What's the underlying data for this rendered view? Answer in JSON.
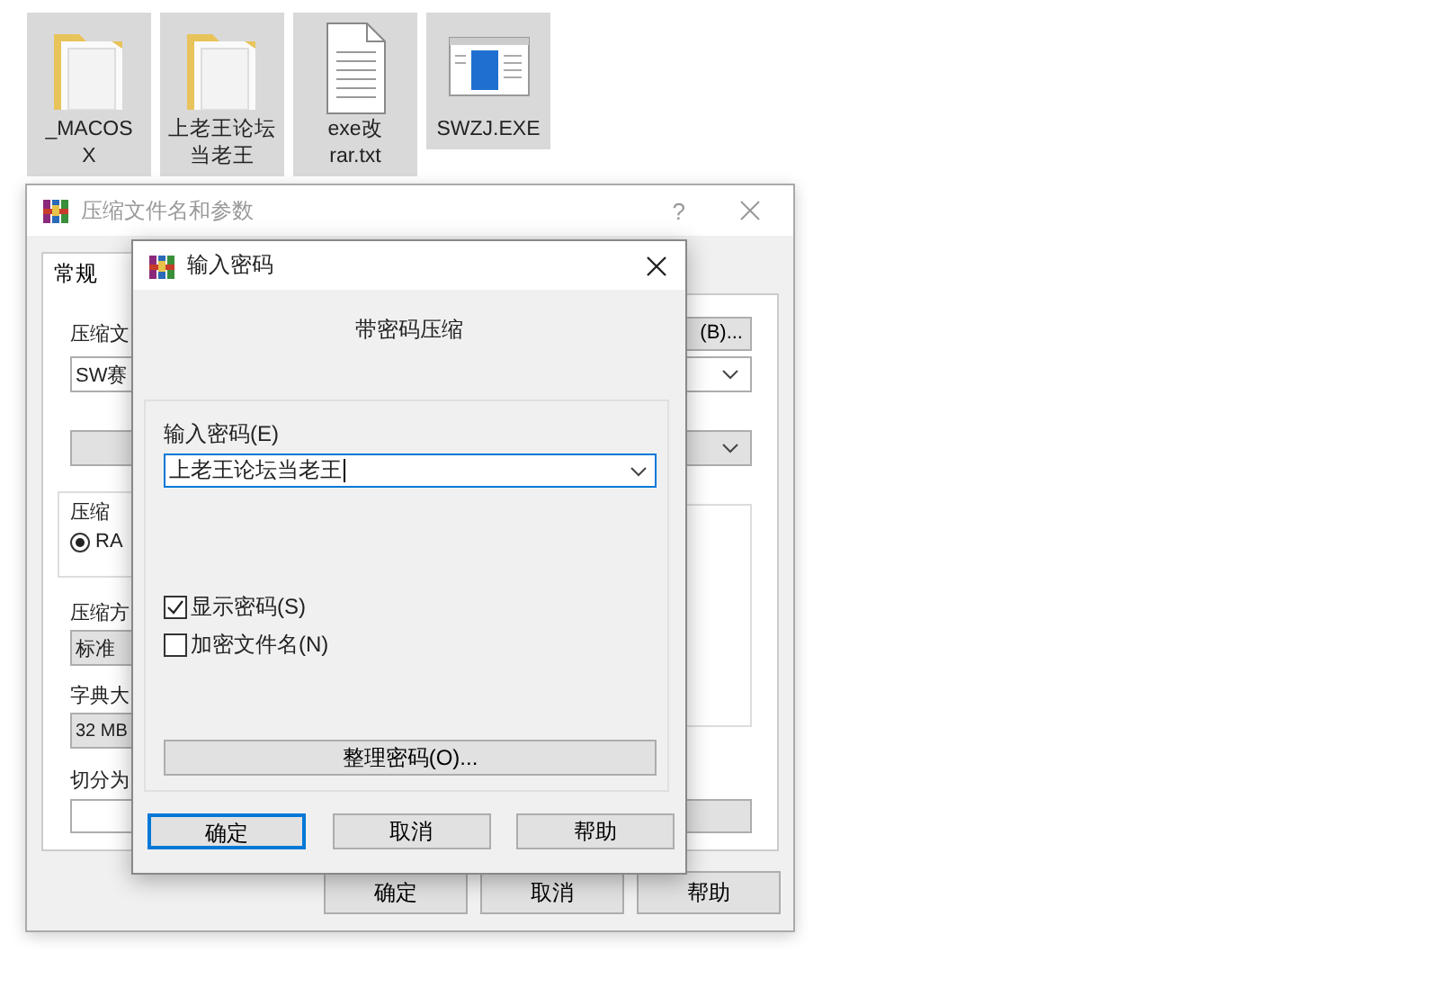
{
  "desktop_icons": [
    {
      "kind": "folder",
      "lines": [
        "_MACOS",
        "X"
      ],
      "selected": true
    },
    {
      "kind": "folder",
      "lines": [
        "上老王论坛",
        "当老王"
      ],
      "selected": true
    },
    {
      "kind": "text",
      "lines": [
        "exe改",
        "rar.txt"
      ],
      "selected": true
    },
    {
      "kind": "exe",
      "lines": [
        "SWZJ.EXE"
      ],
      "selected": true
    }
  ],
  "back_window": {
    "title": "压缩文件名和参数",
    "help": "?",
    "tabs": [
      {
        "label": "常规",
        "selected": true
      }
    ],
    "archive_label": "压缩文",
    "browse_button": "(B)...",
    "archive_name": "SW赛",
    "format_group": "压缩",
    "format_radio": {
      "label": "RA",
      "selected": true
    },
    "method_label": "压缩方",
    "method_value": "标准",
    "dict_label": "字典大",
    "dict_value": "32 MB",
    "split_label": "切分为",
    "buttons": [
      "确定",
      "取消",
      "帮助"
    ]
  },
  "dialog": {
    "title": "输入密码",
    "heading": "带密码压缩",
    "password_label": "输入密码(E)",
    "password_value": "上老王论坛当老王",
    "checkboxes": [
      {
        "label": "显示密码(S)",
        "checked": true
      },
      {
        "label": "加密文件名(N)",
        "checked": false
      }
    ],
    "organize_button": "整理密码(O)...",
    "buttons": [
      {
        "label": "确定",
        "default": true
      },
      {
        "label": "取消",
        "default": false
      },
      {
        "label": "帮助",
        "default": false
      }
    ]
  }
}
